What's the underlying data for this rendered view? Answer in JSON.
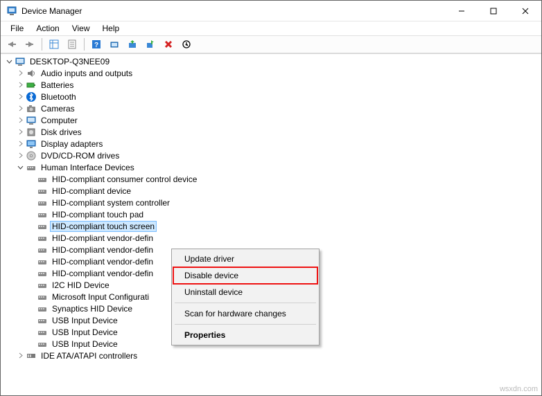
{
  "window": {
    "title": "Device Manager"
  },
  "menubar": [
    "File",
    "Action",
    "View",
    "Help"
  ],
  "tree": {
    "root": "DESKTOP-Q3NEE09",
    "categories": [
      {
        "label": "Audio inputs and outputs",
        "icon": "speaker",
        "expanded": false
      },
      {
        "label": "Batteries",
        "icon": "battery",
        "expanded": false
      },
      {
        "label": "Bluetooth",
        "icon": "bluetooth",
        "expanded": false
      },
      {
        "label": "Cameras",
        "icon": "camera",
        "expanded": false
      },
      {
        "label": "Computer",
        "icon": "computer",
        "expanded": false
      },
      {
        "label": "Disk drives",
        "icon": "disk",
        "expanded": false
      },
      {
        "label": "Display adapters",
        "icon": "display",
        "expanded": false
      },
      {
        "label": "DVD/CD-ROM drives",
        "icon": "dvd",
        "expanded": false
      },
      {
        "label": "Human Interface Devices",
        "icon": "hid",
        "expanded": true,
        "children": [
          {
            "label": "HID-compliant consumer control device"
          },
          {
            "label": "HID-compliant device"
          },
          {
            "label": "HID-compliant system controller"
          },
          {
            "label": "HID-compliant touch pad"
          },
          {
            "label": "HID-compliant touch screen",
            "selected": true,
            "highlight": true
          },
          {
            "label": "HID-compliant vendor-defin",
            "truncated": true
          },
          {
            "label": "HID-compliant vendor-defin",
            "truncated": true
          },
          {
            "label": "HID-compliant vendor-defin",
            "truncated": true
          },
          {
            "label": "HID-compliant vendor-defin",
            "truncated": true
          },
          {
            "label": "I2C HID Device"
          },
          {
            "label": "Microsoft Input Configurati",
            "truncated": true
          },
          {
            "label": "Synaptics HID Device"
          },
          {
            "label": "USB Input Device"
          },
          {
            "label": "USB Input Device"
          },
          {
            "label": "USB Input Device"
          }
        ]
      },
      {
        "label": "IDE ATA/ATAPI controllers",
        "icon": "ide",
        "expanded": false
      }
    ]
  },
  "context_menu": {
    "items": [
      {
        "label": "Update driver"
      },
      {
        "label": "Disable device",
        "highlight": true
      },
      {
        "label": "Uninstall device"
      },
      {
        "sep": true
      },
      {
        "label": "Scan for hardware changes"
      },
      {
        "sep": true
      },
      {
        "label": "Properties",
        "bold": true
      }
    ]
  },
  "watermark": "wsxdn.com"
}
